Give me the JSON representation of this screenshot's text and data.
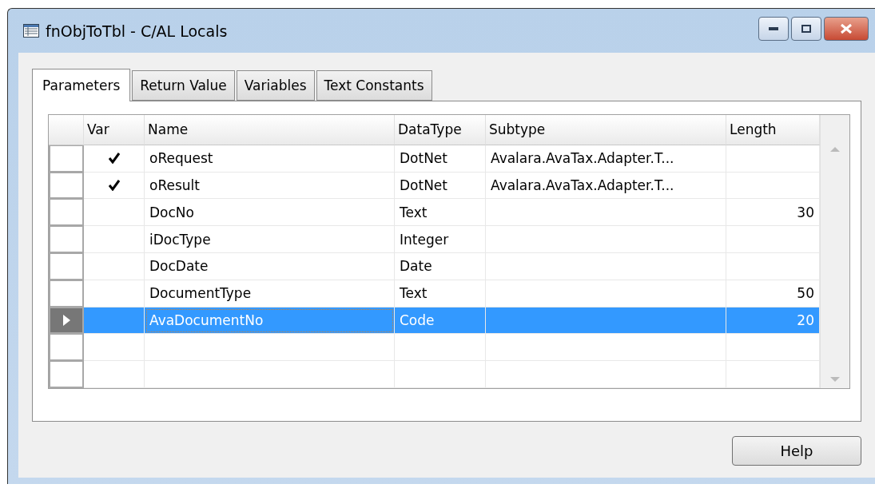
{
  "window": {
    "title": "fnObjToTbl - C/AL Locals"
  },
  "tabs": [
    {
      "label": "Parameters",
      "selected": true
    },
    {
      "label": "Return Value",
      "selected": false
    },
    {
      "label": "Variables",
      "selected": false
    },
    {
      "label": "Text Constants",
      "selected": false
    }
  ],
  "table": {
    "columns": [
      "Var",
      "Name",
      "DataType",
      "Subtype",
      "Length"
    ],
    "rows": [
      {
        "var": true,
        "name": "oRequest",
        "datatype": "DotNet",
        "subtype": "Avalara.AvaTax.Adapter.T...",
        "selected": false
      },
      {
        "var": true,
        "name": "oResult",
        "datatype": "DotNet",
        "subtype": "Avalara.AvaTax.Adapter.T...",
        "selected": false
      },
      {
        "var": false,
        "name": "DocNo",
        "datatype": "Text",
        "length": "30",
        "selected": false
      },
      {
        "var": false,
        "name": "iDocType",
        "datatype": "Integer",
        "selected": false
      },
      {
        "var": false,
        "name": "DocDate",
        "datatype": "Date",
        "selected": false
      },
      {
        "var": false,
        "name": "DocumentType",
        "datatype": "Text",
        "length": "50",
        "selected": false
      },
      {
        "var": false,
        "name": "AvaDocumentNo",
        "datatype": "Code",
        "length": "20",
        "selected": true
      },
      {
        "selected": false
      },
      {
        "selected": false
      }
    ]
  },
  "buttons": [
    "Help"
  ]
}
